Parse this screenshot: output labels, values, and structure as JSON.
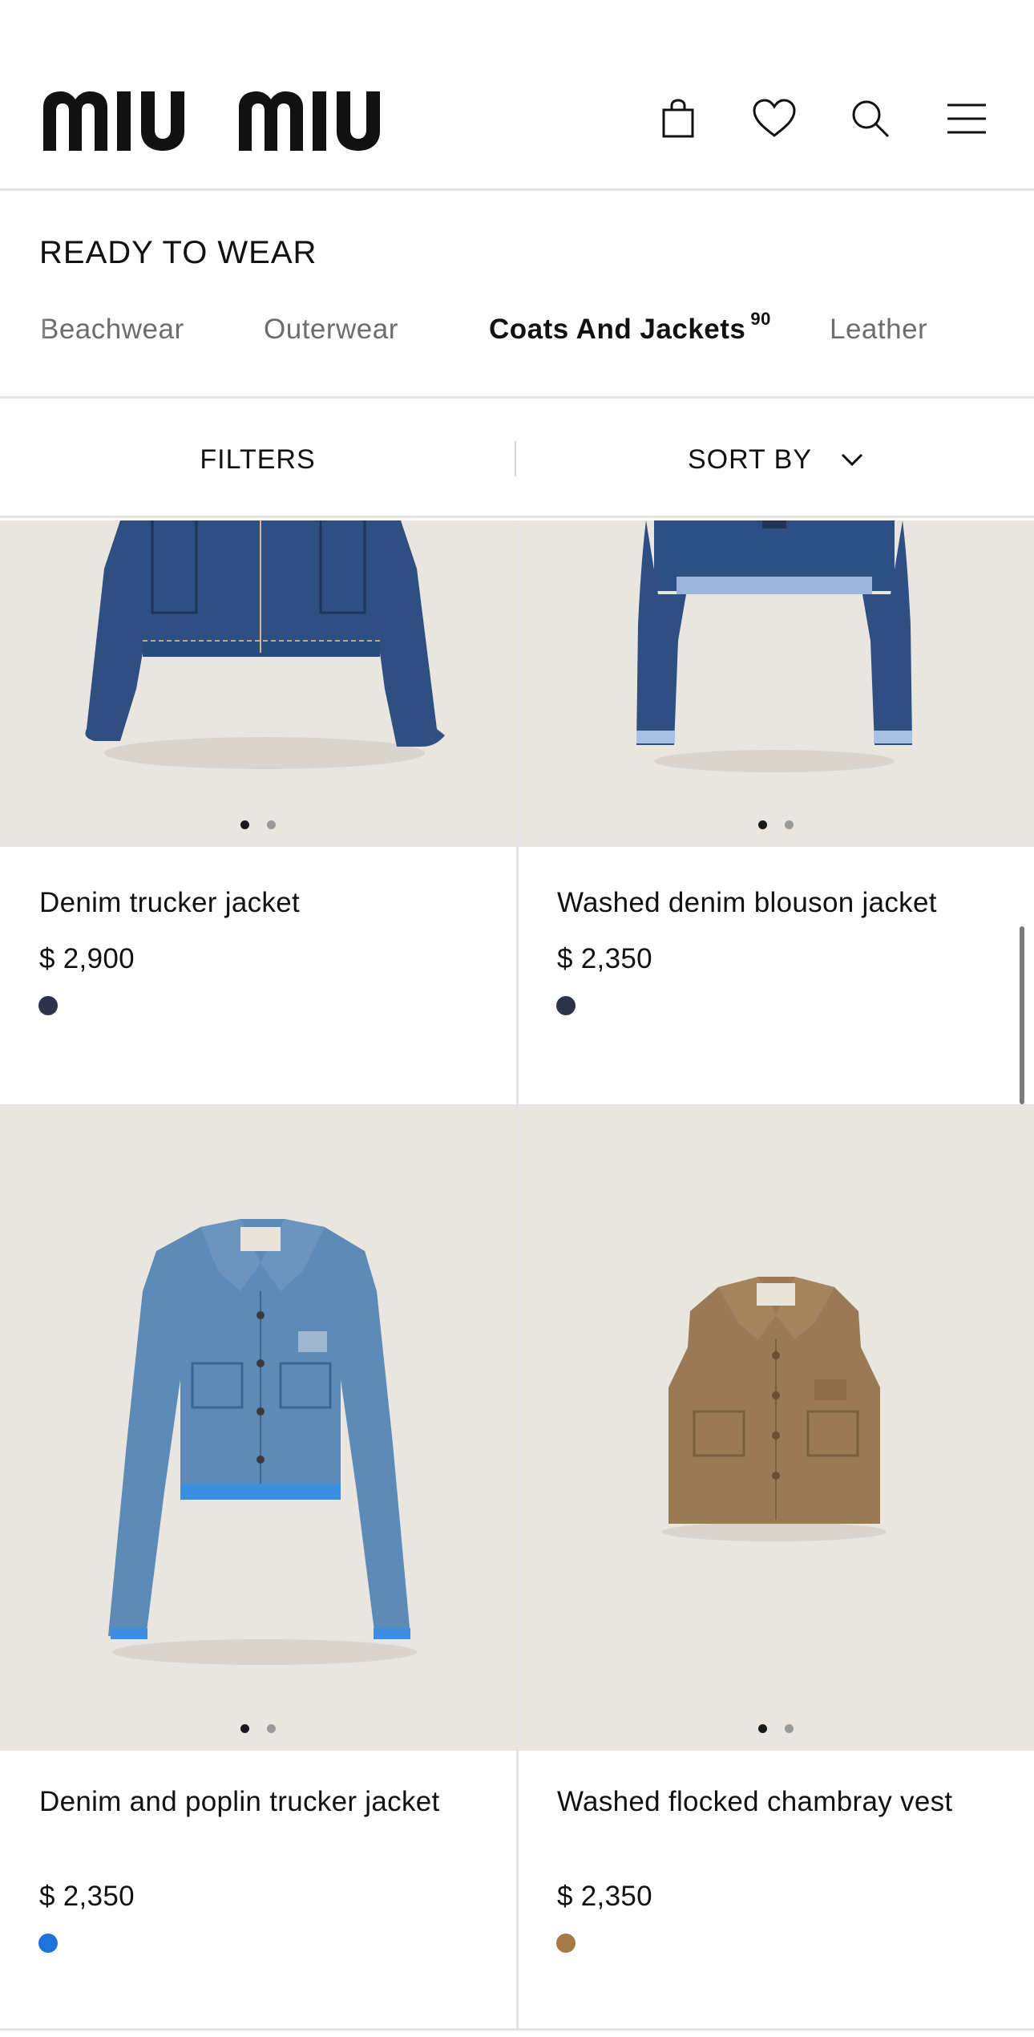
{
  "header": {
    "logo_text": "miu miu",
    "icons": [
      "shopping-bag-icon",
      "heart-icon",
      "search-icon",
      "menu-icon"
    ]
  },
  "section": {
    "title": "READY TO WEAR",
    "categories": [
      {
        "label": "Beachwear",
        "active": false
      },
      {
        "label": "Outerwear",
        "active": false
      },
      {
        "label": "Coats And Jackets",
        "count": "90",
        "active": true
      },
      {
        "label": "Leather",
        "active": false
      }
    ]
  },
  "toolbar": {
    "filters_label": "FILTERS",
    "sort_label": "SORT BY"
  },
  "products": [
    {
      "name": "Denim trucker jacket",
      "price": "$ 2,900",
      "swatch": "#2b3448"
    },
    {
      "name": "Washed denim blouson jacket",
      "price": "$ 2,350",
      "swatch": "#2b3448"
    },
    {
      "name": "Denim and poplin trucker jacket",
      "price": "$ 2,350",
      "swatch": "#1e73d8"
    },
    {
      "name": "Washed flocked chambray vest",
      "price": "$ 2,350",
      "swatch": "#a57a45"
    }
  ],
  "colors": {
    "divider": "#e4e4e4",
    "image_bg": "#e9e6df",
    "text": "#111111",
    "muted": "#6d6d6d"
  }
}
